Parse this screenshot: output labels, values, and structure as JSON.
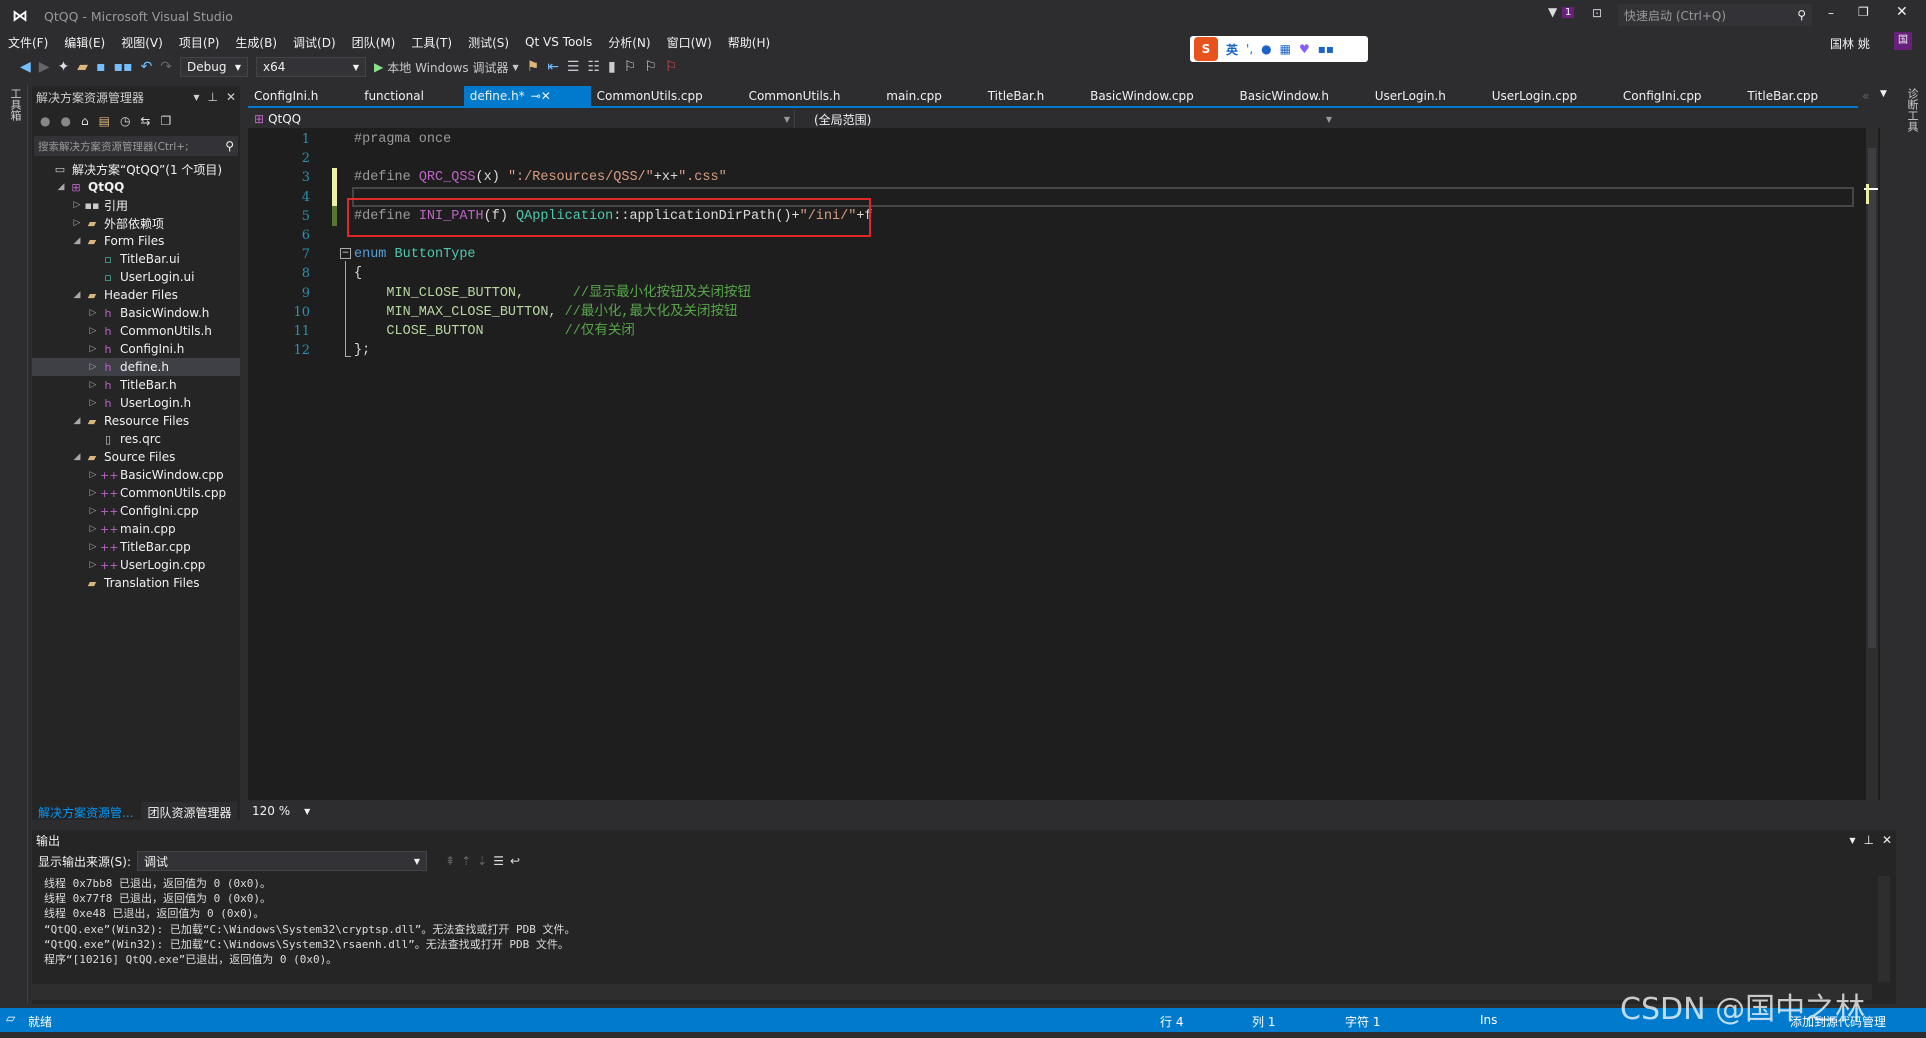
{
  "window": {
    "title": "QtQQ - Microsoft Visual Studio",
    "quick_launch_placeholder": "快速启动 (Ctrl+Q)",
    "notification_count": "1",
    "user_name": "国林 姚",
    "user_initial": "国"
  },
  "menu": [
    "文件(F)",
    "编辑(E)",
    "视图(V)",
    "项目(P)",
    "生成(B)",
    "调试(D)",
    "团队(M)",
    "工具(T)",
    "测试(S)",
    "Qt VS Tools",
    "分析(N)",
    "窗口(W)",
    "帮助(H)"
  ],
  "toolbar": {
    "config": "Debug",
    "platform": "x64",
    "run_label": "本地 Windows 调试器"
  },
  "ime": {
    "mode": "英"
  },
  "left_strip": {
    "label": "工具箱"
  },
  "right_strip": {
    "label": "诊断工具"
  },
  "solution_explorer": {
    "title": "解决方案资源管理器",
    "search_placeholder": "搜索解决方案资源管理器(Ctrl+;",
    "tree": [
      {
        "label": "解决方案“QtQQ”(1 个项目)",
        "level": 0,
        "expander": "",
        "icon": "solution-icon"
      },
      {
        "label": "QtQQ",
        "level": 1,
        "expander": "expanded",
        "icon": "qt-project-icon",
        "bold": true
      },
      {
        "label": "引用",
        "level": 2,
        "expander": "collapsed",
        "icon": "references-icon"
      },
      {
        "label": "外部依赖项",
        "level": 2,
        "expander": "collapsed",
        "icon": "external-deps-icon"
      },
      {
        "label": "Form Files",
        "level": 2,
        "expander": "expanded",
        "icon": "folder-icon"
      },
      {
        "label": "TitleBar.ui",
        "level": 3,
        "expander": "",
        "icon": "ui-file-icon"
      },
      {
        "label": "UserLogin.ui",
        "level": 3,
        "expander": "",
        "icon": "ui-file-icon"
      },
      {
        "label": "Header Files",
        "level": 2,
        "expander": "expanded",
        "icon": "folder-icon"
      },
      {
        "label": "BasicWindow.h",
        "level": 3,
        "expander": "collapsed",
        "icon": "header-file-icon"
      },
      {
        "label": "CommonUtils.h",
        "level": 3,
        "expander": "collapsed",
        "icon": "header-file-icon"
      },
      {
        "label": "ConfigIni.h",
        "level": 3,
        "expander": "collapsed",
        "icon": "header-file-icon"
      },
      {
        "label": "define.h",
        "level": 3,
        "expander": "collapsed",
        "icon": "header-file-icon",
        "selected": true
      },
      {
        "label": "TitleBar.h",
        "level": 3,
        "expander": "collapsed",
        "icon": "header-file-icon"
      },
      {
        "label": "UserLogin.h",
        "level": 3,
        "expander": "collapsed",
        "icon": "header-file-icon"
      },
      {
        "label": "Resource Files",
        "level": 2,
        "expander": "expanded",
        "icon": "folder-icon"
      },
      {
        "label": "res.qrc",
        "level": 3,
        "expander": "",
        "icon": "file-icon"
      },
      {
        "label": "Source Files",
        "level": 2,
        "expander": "expanded",
        "icon": "folder-icon"
      },
      {
        "label": "BasicWindow.cpp",
        "level": 3,
        "expander": "collapsed",
        "icon": "cpp-file-icon"
      },
      {
        "label": "CommonUtils.cpp",
        "level": 3,
        "expander": "collapsed",
        "icon": "cpp-file-icon"
      },
      {
        "label": "ConfigIni.cpp",
        "level": 3,
        "expander": "collapsed",
        "icon": "cpp-file-icon"
      },
      {
        "label": "main.cpp",
        "level": 3,
        "expander": "collapsed",
        "icon": "cpp-file-icon"
      },
      {
        "label": "TitleBar.cpp",
        "level": 3,
        "expander": "collapsed",
        "icon": "cpp-file-icon"
      },
      {
        "label": "UserLogin.cpp",
        "level": 3,
        "expander": "collapsed",
        "icon": "cpp-file-icon"
      },
      {
        "label": "Translation Files",
        "level": 2,
        "expander": "",
        "icon": "folder-icon"
      }
    ],
    "bottom_tabs": [
      "解决方案资源管...",
      "团队资源管理器"
    ]
  },
  "editor": {
    "tabs": [
      {
        "label": "ConfigIni.h"
      },
      {
        "label": "functional"
      },
      {
        "label": "define.h*",
        "active": true
      },
      {
        "label": "CommonUtils.cpp"
      },
      {
        "label": "CommonUtils.h"
      },
      {
        "label": "main.cpp"
      },
      {
        "label": "TitleBar.h"
      },
      {
        "label": "BasicWindow.cpp"
      },
      {
        "label": "BasicWindow.h"
      },
      {
        "label": "UserLogin.h"
      },
      {
        "label": "UserLogin.cpp"
      },
      {
        "label": "ConfigIni.cpp"
      },
      {
        "label": "TitleBar.cpp"
      }
    ],
    "nav_project": "QtQQ",
    "nav_scope": "(全局范围)",
    "zoom": "120 %",
    "highlight_color": "#e0282b",
    "lines": [
      [
        [
          "pp",
          "#pragma once"
        ]
      ],
      [],
      [
        [
          "pp",
          "#define "
        ],
        [
          "mac",
          "QRC_QSS"
        ],
        [
          "",
          "(x) "
        ],
        [
          "str",
          "\":/Resources/QSS/\""
        ],
        [
          "",
          "+x+"
        ],
        [
          "str",
          "\".css\""
        ]
      ],
      [],
      [
        [
          "pp",
          "#define "
        ],
        [
          "mac",
          "INI_PATH"
        ],
        [
          "",
          "(f) "
        ],
        [
          "typ",
          "QApplication"
        ],
        [
          "",
          "::applicationDirPath()+"
        ],
        [
          "str",
          "\"/ini/\""
        ],
        [
          "",
          "+f"
        ]
      ],
      [],
      [
        [
          "kw",
          "enum "
        ],
        [
          "typ",
          "ButtonType"
        ]
      ],
      [
        [
          "",
          "{"
        ]
      ],
      [
        [
          "en",
          "    MIN_CLOSE_BUTTON,      "
        ],
        [
          "cm",
          "//显示最小化按钮及关闭按钮"
        ]
      ],
      [
        [
          "en",
          "    MIN_MAX_CLOSE_BUTTON, "
        ],
        [
          "cm",
          "//最小化,最大化及关闭按钮"
        ]
      ],
      [
        [
          "en",
          "    CLOSE_BUTTON          "
        ],
        [
          "cm",
          "//仅有关闭"
        ]
      ],
      [
        [
          "",
          "};"
        ]
      ]
    ]
  },
  "output": {
    "title": "输出",
    "source_label": "显示输出来源(S):",
    "source_value": "调试",
    "lines": [
      "线程 0x7bb8 已退出，返回值为 0 (0x0)。",
      "线程 0x77f8 已退出，返回值为 0 (0x0)。",
      "线程 0xe48 已退出，返回值为 0 (0x0)。",
      "“QtQQ.exe”(Win32): 已加载“C:\\Windows\\System32\\cryptsp.dll”。无法查找或打开 PDB 文件。",
      "“QtQQ.exe”(Win32): 已加载“C:\\Windows\\System32\\rsaenh.dll”。无法查找或打开 PDB 文件。",
      "程序“[10216] QtQQ.exe”已退出，返回值为 0 (0x0)。"
    ]
  },
  "status": {
    "ready": "就绪",
    "line": "行 4",
    "col": "列 1",
    "char": "字符 1",
    "mode": "Ins",
    "source_control": "添加到源代码管理"
  },
  "watermark": "CSDN @国中之林",
  "colors": {
    "accent": "#007acc",
    "background": "#1e1e1e",
    "chrome": "#2d2d30"
  }
}
